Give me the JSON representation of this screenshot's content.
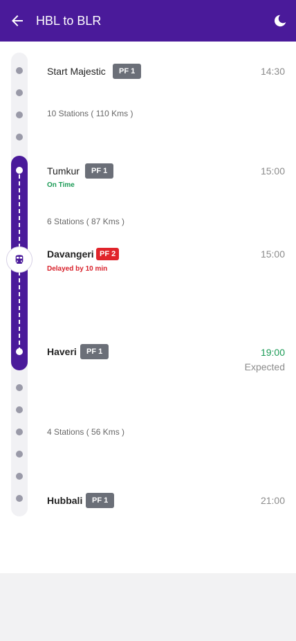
{
  "header": {
    "title": "HBL to BLR",
    "back_icon": "arrow-left-icon",
    "theme_icon": "moon-icon",
    "background": "#4a1a9a"
  },
  "stations": [
    {
      "name": "Start Majestic",
      "platform": "PF 1",
      "time": "14:30",
      "platform_color": "#6b6f78"
    },
    {
      "name": "Tumkur",
      "platform": "PF 1",
      "time": "15:00",
      "status": "On Time",
      "status_color": "#1a9a55",
      "platform_color": "#6b6f78"
    },
    {
      "name": "Davangeri",
      "platform": "PF 2",
      "time": "15:00",
      "status": "Delayed by 10 min",
      "status_color": "#d8202a",
      "platform_color": "#e0242b"
    },
    {
      "name": "Haveri",
      "platform": "PF 1",
      "time": "19:00",
      "time_note": "Expected",
      "time_color": "#1a9a55",
      "platform_color": "#6b6f78"
    },
    {
      "name": "Hubbali",
      "platform": "PF 1",
      "time": "21:00",
      "platform_color": "#6b6f78"
    }
  ],
  "segments": [
    "10 Stations ( 110 Kms )",
    "6 Stations ( 87 Kms )",
    "4 Stations ( 56 Kms )"
  ],
  "train_icon": "train-icon",
  "accent_color": "#4a1a9a"
}
